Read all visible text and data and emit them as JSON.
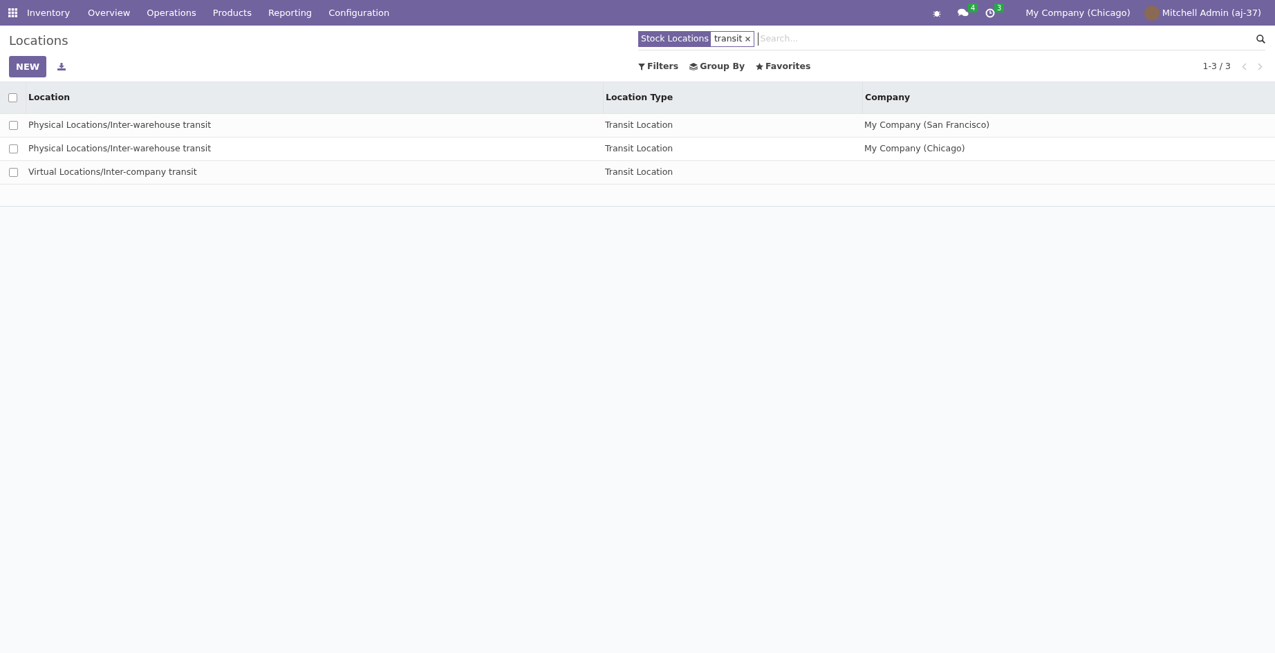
{
  "navbar": {
    "app": "Inventory",
    "menu": [
      "Overview",
      "Operations",
      "Products",
      "Reporting",
      "Configuration"
    ],
    "messages_count": "4",
    "activities_count": "3",
    "company": "My Company (Chicago)",
    "user": "Mitchell Admin (aj-37)"
  },
  "control_panel": {
    "title": "Locations",
    "new_button": "NEW",
    "search": {
      "facet_label": "Stock Locations",
      "facet_value": "transit",
      "placeholder": "Search..."
    },
    "filters": "Filters",
    "group_by": "Group By",
    "favorites": "Favorites",
    "pager": "1-3 / 3"
  },
  "table": {
    "select_all_checked": false,
    "columns": [
      "Location",
      "Location Type",
      "Company"
    ],
    "rows": [
      {
        "checked": false,
        "cells": [
          "Physical Locations/Inter-warehouse transit",
          "Transit Location",
          "My Company (San Francisco)"
        ]
      },
      {
        "checked": false,
        "cells": [
          "Physical Locations/Inter-warehouse transit",
          "Transit Location",
          "My Company (Chicago)"
        ]
      },
      {
        "checked": false,
        "cells": [
          "Virtual Locations/Inter-company transit",
          "Transit Location",
          ""
        ]
      }
    ]
  }
}
